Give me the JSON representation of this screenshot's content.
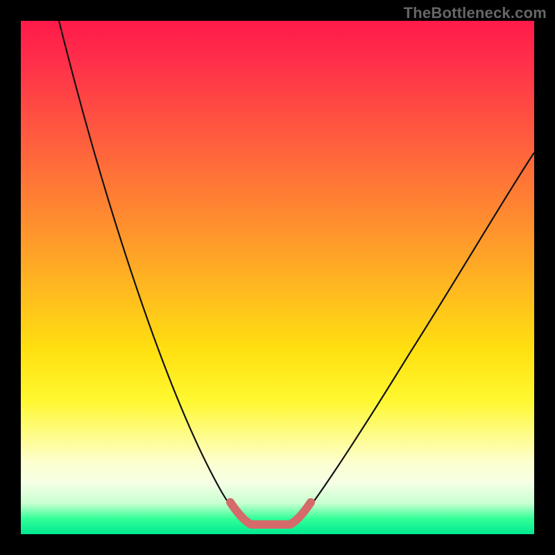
{
  "watermark": "TheBottleneck.com",
  "chart_data": {
    "type": "line",
    "title": "",
    "xlabel": "",
    "ylabel": "",
    "xlim": [
      0,
      100
    ],
    "ylim": [
      0,
      100
    ],
    "background_gradient": {
      "orientation": "vertical",
      "stops": [
        {
          "pos": 0.0,
          "color": "#ff1a4a"
        },
        {
          "pos": 0.22,
          "color": "#ff5a3f"
        },
        {
          "pos": 0.52,
          "color": "#ffb820"
        },
        {
          "pos": 0.74,
          "color": "#fff830"
        },
        {
          "pos": 0.9,
          "color": "#f5ffe5"
        },
        {
          "pos": 1.0,
          "color": "#00e890"
        }
      ]
    },
    "series": [
      {
        "name": "left_curve",
        "color": "#111111",
        "x": [
          7,
          12,
          18,
          24,
          30,
          36,
          40,
          43
        ],
        "y": [
          100,
          80,
          60,
          42,
          26,
          12,
          4,
          2
        ]
      },
      {
        "name": "right_curve",
        "color": "#111111",
        "x": [
          54,
          58,
          64,
          72,
          80,
          90,
          100
        ],
        "y": [
          2,
          4,
          12,
          26,
          42,
          60,
          74
        ]
      },
      {
        "name": "bottom_u",
        "color": "#d46a6a",
        "thick": true,
        "x": [
          41,
          43,
          45,
          52,
          54,
          56
        ],
        "y": [
          6,
          2,
          1,
          1,
          2,
          6
        ]
      }
    ],
    "annotations": [
      {
        "text": "TheBottleneck.com",
        "position": "top-right",
        "color": "#666666"
      }
    ]
  }
}
